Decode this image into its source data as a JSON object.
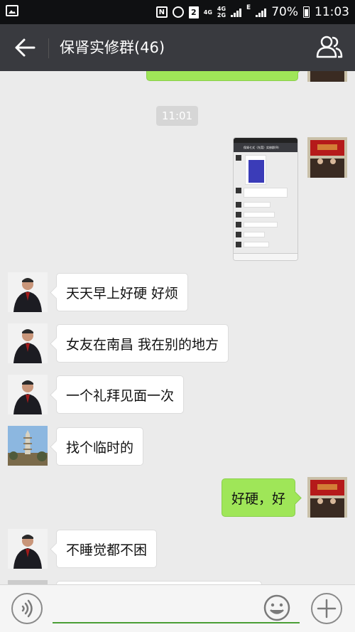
{
  "status_bar": {
    "network_top": "4G",
    "network_bottom": "2G",
    "network2_top": "4G",
    "data_type": "E",
    "sim_slot": "2",
    "nfc_label": "N",
    "battery_percent": "70%",
    "time": "11:03"
  },
  "header": {
    "back_icon": "arrow-left-icon",
    "title": "保肾实修群(46)",
    "group_icon": "group-members-icon"
  },
  "chat": {
    "timestamp": "11:01",
    "messages": [
      {
        "side": "right",
        "type": "text",
        "text": "",
        "partial": true
      },
      {
        "side": "right",
        "type": "image",
        "description_icon": "chat-screenshot-image"
      },
      {
        "side": "left",
        "type": "text",
        "text": "天天早上好硬 好烦"
      },
      {
        "side": "left",
        "type": "text",
        "text": "女友在南昌 我在别的地方"
      },
      {
        "side": "left",
        "type": "text",
        "text": "一个礼拜见面一次"
      },
      {
        "side": "left",
        "type": "text",
        "text": "找个临时的"
      },
      {
        "side": "right",
        "type": "text",
        "text": "好硬，好"
      },
      {
        "side": "left",
        "type": "text",
        "text": "不睡觉都不困"
      }
    ],
    "thumbnail": {
      "title": "保肾七式（东莞）实修群(9)"
    }
  },
  "input_bar": {
    "voice_icon": "voice-icon",
    "emoji_icon": "emoji-smile-icon",
    "plus_icon": "plus-icon"
  },
  "colors": {
    "status_bar_bg": "#0f1012",
    "title_bar_bg": "#393a3f",
    "chat_bg": "#ebebeb",
    "bubble_sent": "#9fe658",
    "bubble_received": "#ffffff",
    "input_underline": "#4a9e36"
  }
}
